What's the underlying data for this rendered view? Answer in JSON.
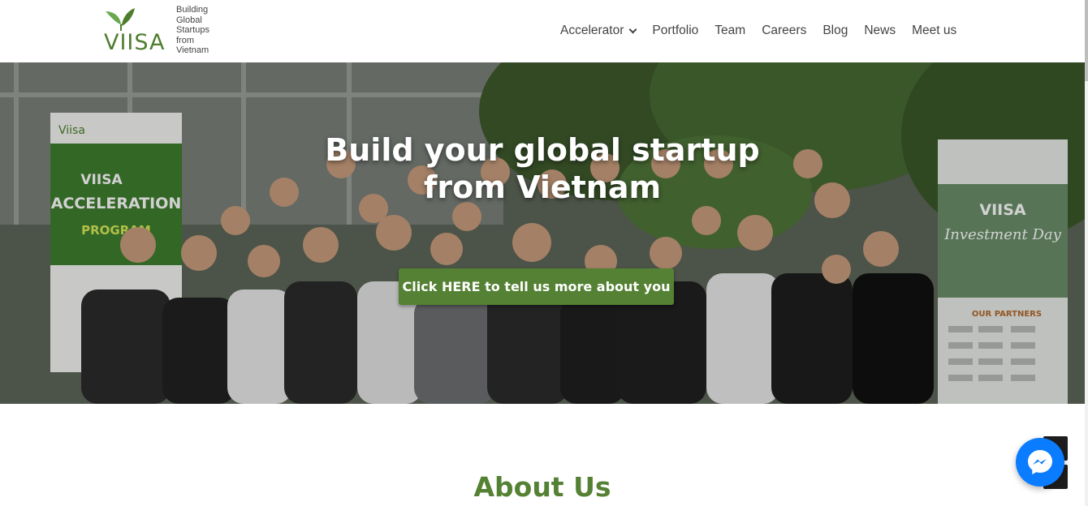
{
  "brand": {
    "logo_text": "VIISA",
    "tagline": [
      "Building",
      "Global",
      "Startups",
      "from",
      "Vietnam"
    ],
    "color": "#4e7e2d"
  },
  "nav": {
    "items": [
      {
        "label": "Accelerator",
        "has_dropdown": true
      },
      {
        "label": "Portfolio"
      },
      {
        "label": "Team"
      },
      {
        "label": "Careers"
      },
      {
        "label": "Blog"
      },
      {
        "label": "News"
      },
      {
        "label": "Meet us"
      }
    ]
  },
  "hero": {
    "title_lines": [
      "Build your global startup",
      "from Vietnam"
    ],
    "cta_label": "Click HERE to tell us more about you",
    "cta_color": "#548133",
    "banner_left": {
      "brand": "VIISA",
      "lines": [
        "VIISA",
        "ACCELERATION",
        "PROGRAM"
      ]
    },
    "banner_right": {
      "lines": [
        "VIISA",
        "Investment Day"
      ],
      "partners_heading": "OUR PARTNERS"
    }
  },
  "about": {
    "title": "About Us",
    "color": "#548133"
  },
  "widgets": {
    "messenger_icon": "messenger-icon",
    "messenger_color": "#0a7cff"
  }
}
